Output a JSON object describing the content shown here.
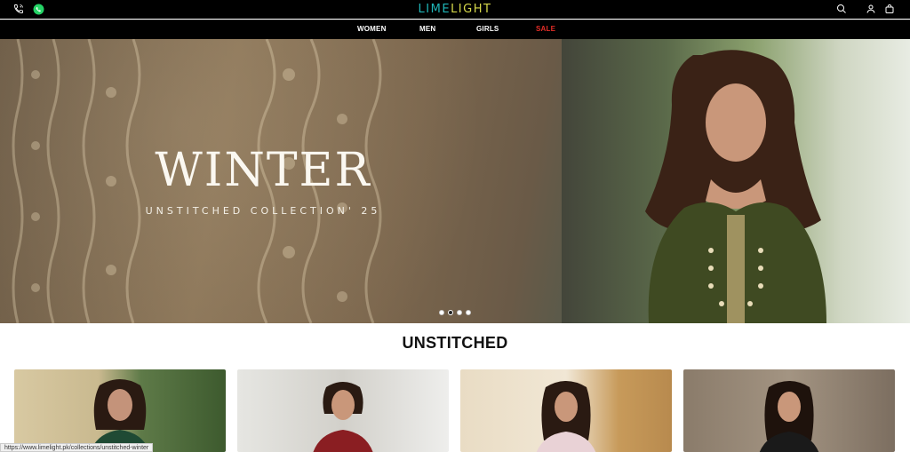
{
  "header": {
    "logo_part1": "LIME",
    "logo_part2": "LIGHT"
  },
  "nav": {
    "items": [
      "WOMEN",
      "MEN",
      "GIRLS",
      "SALE"
    ]
  },
  "hero": {
    "title": "WINTER",
    "subtitle": "UNSTITCHED COLLECTION' 25",
    "active_slide": 2,
    "slide_count": 4
  },
  "section": {
    "title": "UNSTITCHED"
  },
  "status_url": "https://www.limelight.pk/collections/unstitched-winter",
  "icons": {
    "phone": "phone-icon",
    "whatsapp": "whatsapp-icon",
    "search": "search-icon",
    "account": "account-icon",
    "cart": "cart-icon"
  },
  "colors": {
    "sale": "#e52d27",
    "logo_lime": "#1fb6b8",
    "logo_light": "#d6d84a"
  }
}
